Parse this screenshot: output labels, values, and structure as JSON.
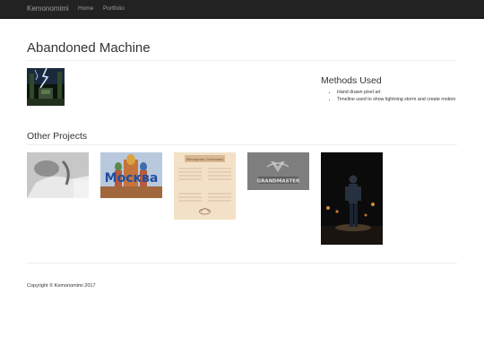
{
  "navbar": {
    "brand": "Kemonomimi",
    "links": [
      {
        "label": "Home"
      },
      {
        "label": "Portfolio"
      }
    ]
  },
  "page": {
    "title": "Abandoned Machine"
  },
  "methods": {
    "title": "Methods Used",
    "items": [
      "Hand drawn pixel art",
      "Timeline used to show lightning storm and create motion"
    ]
  },
  "other_projects": {
    "title": "Other Projects",
    "thumbnails": [
      {
        "icon": "grayscale-photo-thumbnail"
      },
      {
        "icon": "moscow-cathedral-thumbnail",
        "text": "Москва"
      },
      {
        "icon": "vintage-menu-thumbnail",
        "text": "Bourgeois Croissant"
      },
      {
        "icon": "engraved-logo-thumbnail",
        "text": "GRANDMASTER"
      },
      {
        "icon": "figure-on-stage-thumbnail"
      }
    ]
  },
  "footer": {
    "copyright": "Copyright © Kemonomimi 2017"
  },
  "colors": {
    "navbar_bg": "#222222",
    "navbar_text": "#9d9d9d",
    "body_text": "#333333",
    "rule": "#eeeeee"
  }
}
